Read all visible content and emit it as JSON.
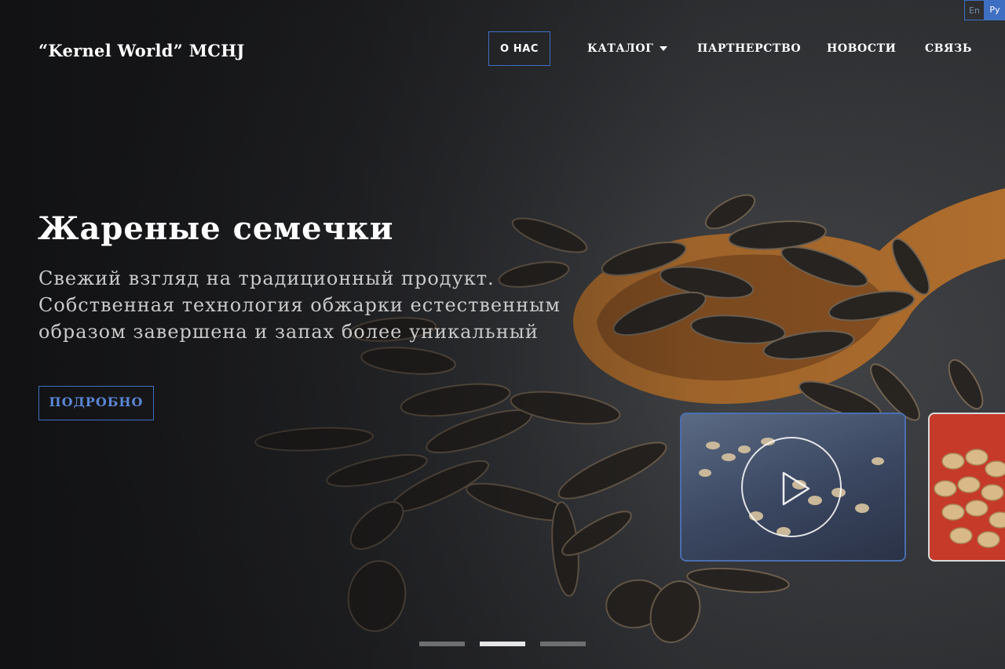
{
  "brand": {
    "name": "“Kernel World” MCHJ"
  },
  "nav": {
    "about": "О НАС",
    "catalog": "КАТАЛОГ",
    "partnership": "ПАРТНЕРСТВО",
    "news": "НОВОСТИ",
    "contact": "СВЯЗЬ"
  },
  "lang": {
    "en": "En",
    "ru": "Ру",
    "active": "ru"
  },
  "hero": {
    "title": "Жареные семечки",
    "text": "Свежий взгляд на традиционный продукт. Собственная технология обжарки естественным образом завершена и запах более уникальный",
    "button": "ПОДРОБНО"
  },
  "slider": {
    "slide_count": 3,
    "active_slide": 2
  },
  "colors": {
    "accent": "#3f6fc2",
    "button_text": "#5b86d6",
    "background": "#2e3033"
  }
}
